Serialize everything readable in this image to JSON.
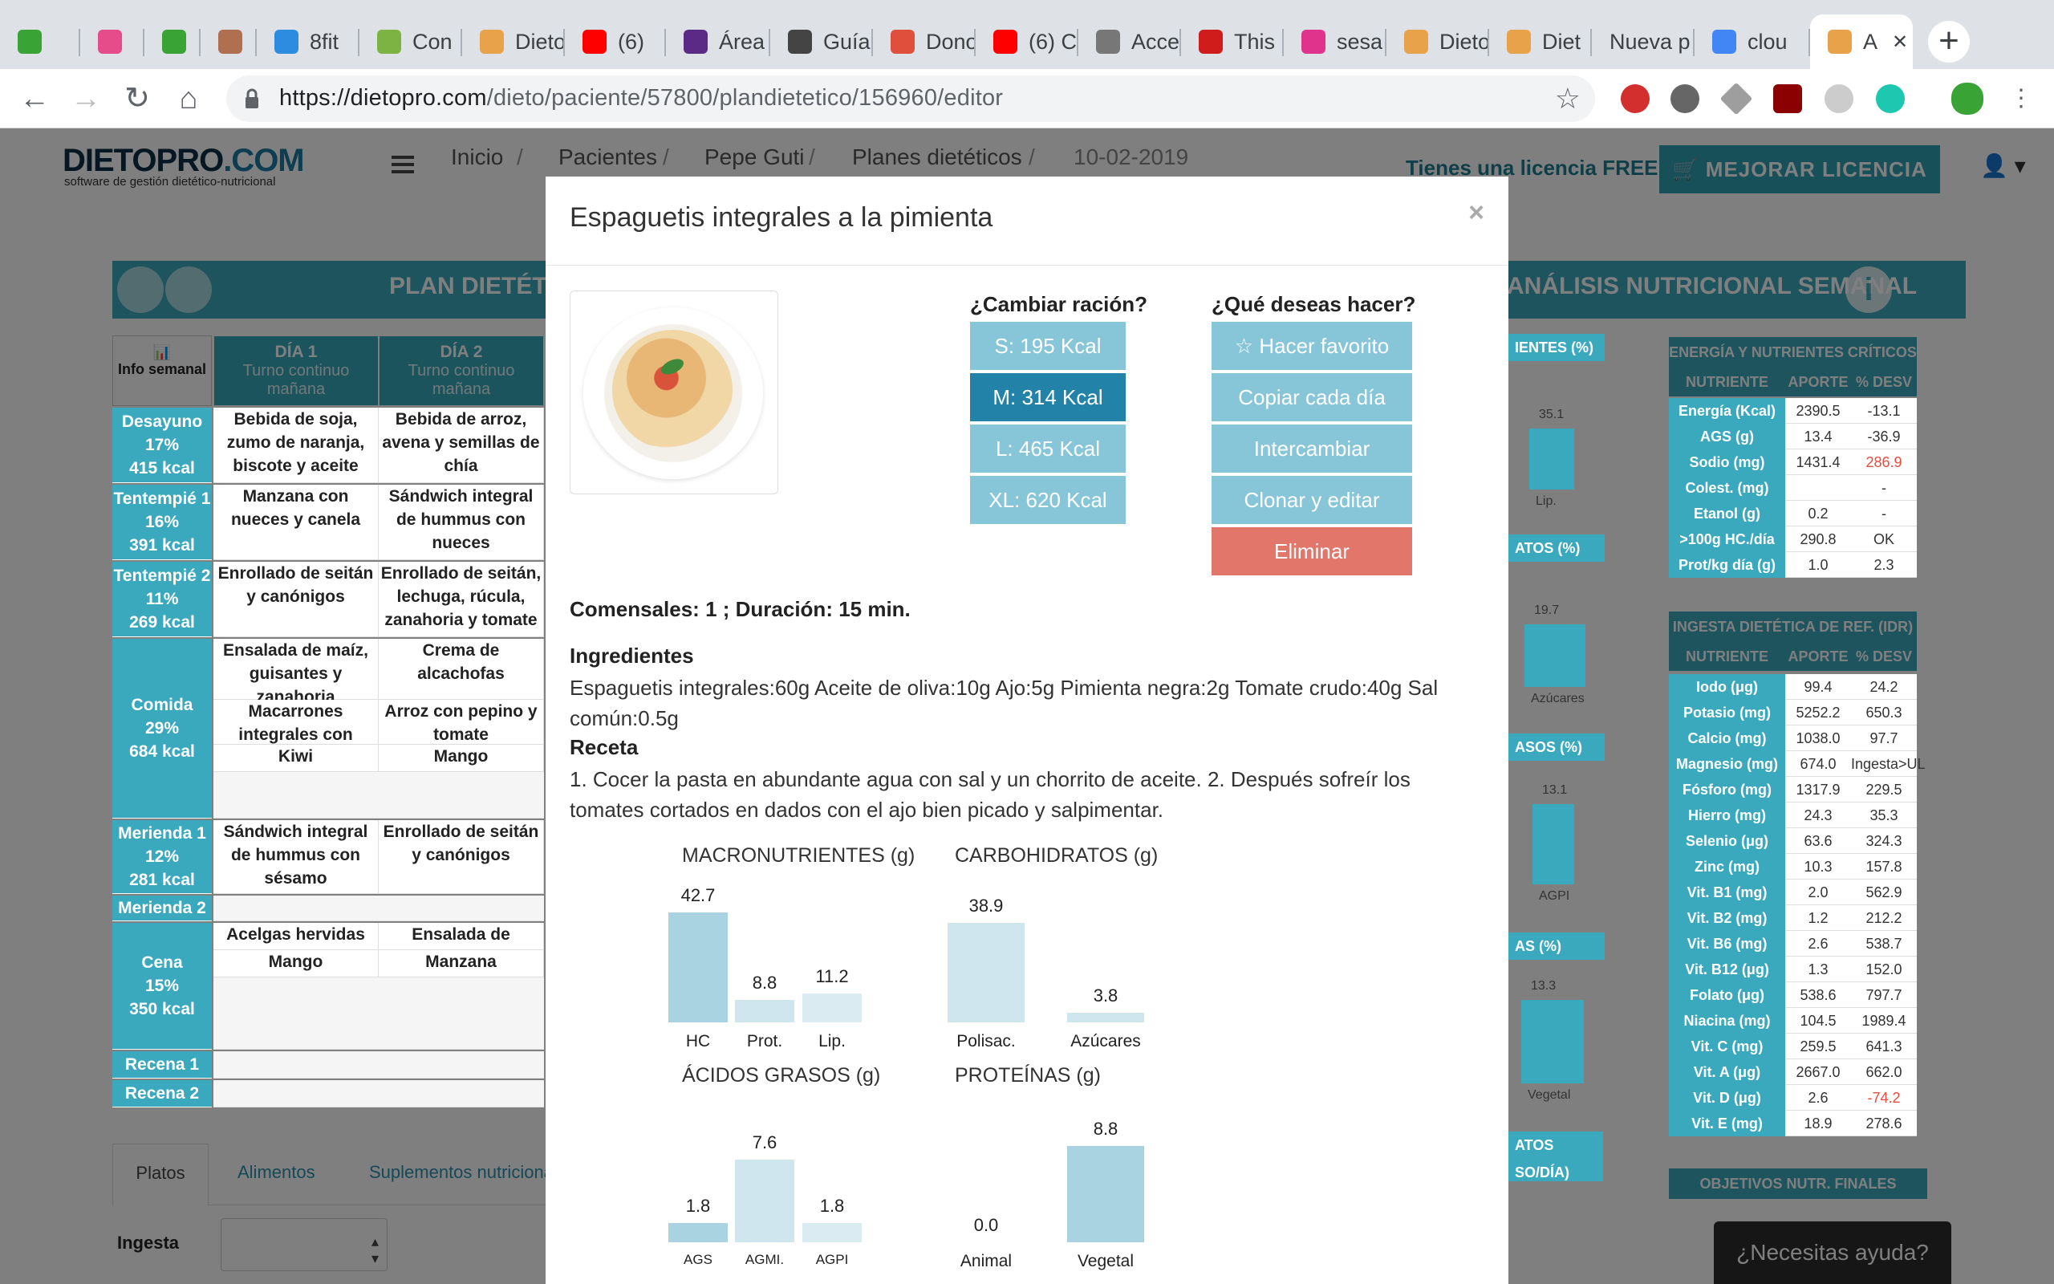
{
  "browser": {
    "tabs": [
      {
        "label": "",
        "icon": "frog-icon",
        "color": "#3aa335"
      },
      {
        "label": "",
        "icon": "ck-icon",
        "color": "#e74c8a"
      },
      {
        "label": "",
        "icon": "leaf-icon",
        "color": "#3aa335"
      },
      {
        "label": "",
        "icon": "avatar-icon",
        "color": "#b07050"
      },
      {
        "label": "8fit",
        "icon": "play-icon",
        "color": "#2e8ce0"
      },
      {
        "label": "Con",
        "icon": "android-icon",
        "color": "#7cb342"
      },
      {
        "label": "Dieto",
        "icon": "grid-icon",
        "color": "#e8a34a"
      },
      {
        "label": "(6)",
        "icon": "youtube-icon",
        "color": "#ff0000"
      },
      {
        "label": "Área",
        "icon": "quote-icon",
        "color": "#5b2a86"
      },
      {
        "label": "Guía",
        "icon": "link-icon",
        "color": "#444444"
      },
      {
        "label": "Dono",
        "icon": "shield-icon",
        "color": "#e04f3c"
      },
      {
        "label": "(6) C",
        "icon": "youtube-icon",
        "color": "#ff0000"
      },
      {
        "label": "Acce",
        "icon": "page-icon",
        "color": "#777777"
      },
      {
        "label": "This",
        "icon": "globe-icon",
        "color": "#d11c1c"
      },
      {
        "label": "sesa",
        "icon": "c-icon",
        "color": "#e0348c"
      },
      {
        "label": "Dieto",
        "icon": "grid-icon",
        "color": "#e8a34a"
      },
      {
        "label": "Diet",
        "icon": "grid-icon",
        "color": "#e8a34a"
      },
      {
        "label": "Nueva p",
        "icon": "",
        "color": ""
      },
      {
        "label": "clou",
        "icon": "google-icon",
        "color": "#4285f4"
      },
      {
        "label": "A",
        "icon": "grid-icon",
        "color": "#e8a34a"
      }
    ],
    "url_domain": "https://dietopro.com",
    "url_path": "/dieto/paciente/57800/plandietetico/156960/editor"
  },
  "app": {
    "logo_main": "DIETOPRO",
    "logo_tld": ".COM",
    "logo_sub": "software de gestión dietético-nutricional",
    "breadcrumb": [
      "Inicio",
      "Pacientes",
      "Pepe Guti",
      "Planes dietéticos",
      "10-02-2019"
    ],
    "license_msg": "Tienes una licencia FREE",
    "upgrade_label": "MEJORAR LICENCIA",
    "help_label": "¿Necesitas ayuda?"
  },
  "plan": {
    "title": "PLAN DIETÉTICO",
    "analysis_title": "ANÁLISIS NUTRICIONAL SEMANAL",
    "week_info": "Info semanal",
    "days": [
      {
        "name": "DÍA 1",
        "shift": "Turno continuo mañana"
      },
      {
        "name": "DÍA 2",
        "shift": "Turno continuo mañana"
      }
    ],
    "meals": [
      {
        "name": "Desayuno",
        "pct": "17%",
        "kcal": "415 kcal",
        "d1": [
          "Bebida de soja, zumo de naranja, biscote y aceite"
        ],
        "d2": [
          "Bebida de arroz, avena y semillas de chía"
        ]
      },
      {
        "name": "Tentempié 1",
        "pct": "16%",
        "kcal": "391 kcal",
        "d1": [
          "Manzana con nueces y canela"
        ],
        "d2": [
          "Sándwich integral de hummus con nueces"
        ]
      },
      {
        "name": "Tentempié 2",
        "pct": "11%",
        "kcal": "269 kcal",
        "d1": [
          "Enrollado de seitán y canónigos"
        ],
        "d2": [
          "Enrollado de seitán, lechuga, rúcula, zanahoria y tomate"
        ]
      },
      {
        "name": "Comida",
        "pct": "29%",
        "kcal": "684 kcal",
        "d1": [
          "Ensalada de maíz, guisantes y zanahoria",
          "Macarrones integrales con tomate",
          "Kiwi"
        ],
        "d2": [
          "Crema de alcachofas",
          "Arroz con pepino y tomate",
          "Mango"
        ]
      },
      {
        "name": "Merienda 1",
        "pct": "12%",
        "kcal": "281 kcal",
        "d1": [
          "Sándwich integral de hummus con sésamo"
        ],
        "d2": [
          "Enrollado de seitán y canónigos"
        ]
      },
      {
        "name": "Merienda 2",
        "pct": "",
        "kcal": "",
        "d1": [],
        "d2": []
      },
      {
        "name": "Cena",
        "pct": "15%",
        "kcal": "350 kcal",
        "d1": [
          "Acelgas hervidas",
          "Mango"
        ],
        "d2": [
          "Ensalada de lechuga completa",
          "Manzana"
        ]
      },
      {
        "name": "Recena 1",
        "pct": "",
        "kcal": "",
        "d1": [],
        "d2": []
      },
      {
        "name": "Recena 2",
        "pct": "",
        "kcal": "",
        "d1": [],
        "d2": []
      }
    ],
    "bottom_tabs": [
      "Platos",
      "Alimentos",
      "Suplementos nutriciona"
    ],
    "ingesta_label": "Ingesta"
  },
  "analysis": {
    "mid_heads": [
      "IENTES (%)",
      "ATOS (%)",
      "ASOS (%)",
      "AS (%)",
      "ATOS SO/DÍA)"
    ],
    "mid_values": [
      "35.1",
      "19.7",
      "13.1",
      "13.3"
    ],
    "mid_labels": [
      "Lip.",
      "Azúcares",
      "AGPI",
      "Vegetal"
    ],
    "critical_title": "ENERGÍA Y NUTRIENTES CRÍTICOS",
    "col_headers": [
      "NUTRIENTE",
      "APORTE",
      "% DESV"
    ],
    "critical": [
      [
        "Energía (Kcal)",
        "2390.5",
        "-13.1",
        false
      ],
      [
        "AGS (g)",
        "13.4",
        "-36.9",
        false
      ],
      [
        "Sodio (mg)",
        "1431.4",
        "286.9",
        true
      ],
      [
        "Colest. (mg)",
        "",
        "-",
        false
      ],
      [
        "Etanol (g)",
        "0.2",
        "-",
        false
      ],
      [
        ">100g HC./día",
        "290.8",
        "OK",
        false
      ],
      [
        "Prot/kg día (g)",
        "1.0",
        "2.3",
        false
      ]
    ],
    "idr_title": "INGESTA DIETÉTICA DE REF. (IDR)",
    "idr": [
      [
        "Iodo (μg)",
        "99.4",
        "24.2",
        false
      ],
      [
        "Potasio (mg)",
        "5252.2",
        "650.3",
        false
      ],
      [
        "Calcio (mg)",
        "1038.0",
        "97.7",
        false
      ],
      [
        "Magnesio (mg)",
        "674.0",
        "Ingesta>UL",
        false
      ],
      [
        "Fósforo (mg)",
        "1317.9",
        "229.5",
        false
      ],
      [
        "Hierro (mg)",
        "24.3",
        "35.3",
        false
      ],
      [
        "Selenio (μg)",
        "63.6",
        "324.3",
        false
      ],
      [
        "Zinc (mg)",
        "10.3",
        "157.8",
        false
      ],
      [
        "Vit. B1 (mg)",
        "2.0",
        "562.9",
        false
      ],
      [
        "Vit. B2 (mg)",
        "1.2",
        "212.2",
        false
      ],
      [
        "Vit. B6 (mg)",
        "2.6",
        "538.7",
        false
      ],
      [
        "Vit. B12 (μg)",
        "1.3",
        "152.0",
        false
      ],
      [
        "Folato (μg)",
        "538.6",
        "797.7",
        false
      ],
      [
        "Niacina (mg)",
        "104.5",
        "1989.4",
        false
      ],
      [
        "Vit. C (mg)",
        "259.5",
        "641.3",
        false
      ],
      [
        "Vit. A (μg)",
        "2667.0",
        "662.0",
        false
      ],
      [
        "Vit. D (μg)",
        "2.6",
        "-74.2",
        true
      ],
      [
        "Vit. E (mg)",
        "18.9",
        "278.6",
        false
      ]
    ],
    "final_title": "OBJETIVOS NUTR. FINALES"
  },
  "modal": {
    "title": "Espaguetis integrales a la pimienta",
    "close": "×",
    "change_portion": "¿Cambiar ración?",
    "what_to_do": "¿Qué deseas hacer?",
    "portions": [
      "S: 195 Kcal",
      "M: 314 Kcal",
      "L: 465 Kcal",
      "XL: 620 Kcal"
    ],
    "selected_portion": 1,
    "actions": [
      "☆ Hacer favorito",
      "Copiar cada día",
      "Intercambiar",
      "Clonar y editar",
      "Eliminar"
    ],
    "servings": "Comensales: 1 ; Duración: 15 min.",
    "ingredients_title": "Ingredientes",
    "ingredients": "Espaguetis integrales:60g Aceite de oliva:10g Ajo:5g Pimienta negra:2g Tomate crudo:40g Sal común:0.5g",
    "recipe_title": "Receta",
    "recipe": "1. Cocer la pasta en abundante agua con sal y un chorrito de aceite.  2. Después sofreír los tomates cortados en dados con el ajo bien picado y salpimentar."
  },
  "chart_data": [
    {
      "type": "bar",
      "title": "MACRONUTRIENTES (g)",
      "categories": [
        "HC",
        "Prot.",
        "Lip."
      ],
      "values": [
        42.7,
        8.8,
        11.2
      ]
    },
    {
      "type": "bar",
      "title": "CARBOHIDRATOS (g)",
      "categories": [
        "Polisac.",
        "Azúcares"
      ],
      "values": [
        38.9,
        3.8
      ]
    },
    {
      "type": "bar",
      "title": "ÁCIDOS GRASOS (g)",
      "categories": [
        "AGS",
        "AGMI.",
        "AGPI"
      ],
      "values": [
        1.8,
        7.6,
        1.8
      ]
    },
    {
      "type": "bar",
      "title": "PROTEÍNAS (g)",
      "categories": [
        "Animal",
        "Vegetal"
      ],
      "values": [
        0.0,
        8.8
      ]
    }
  ]
}
